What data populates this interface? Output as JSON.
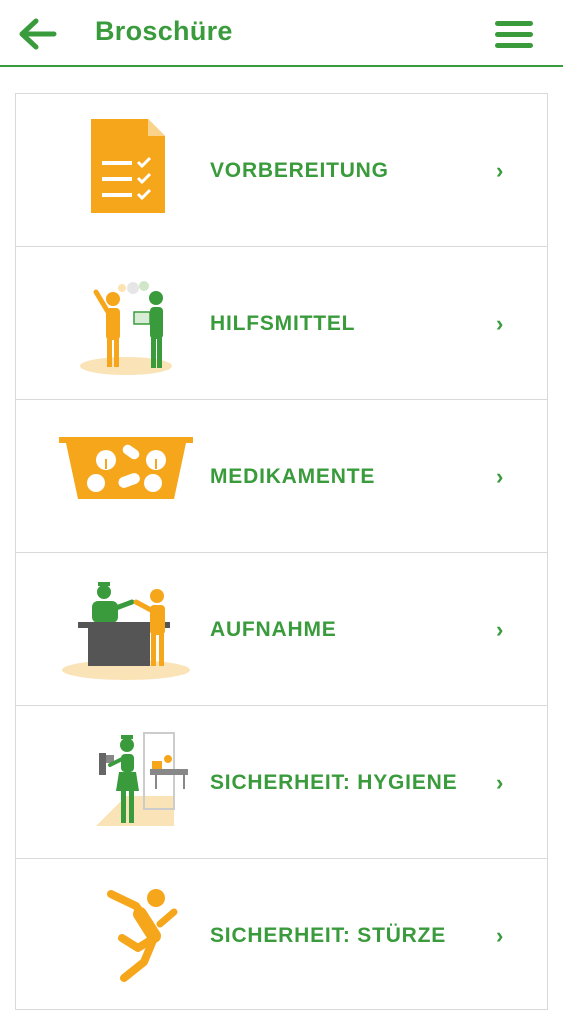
{
  "header": {
    "title": "Broschüre",
    "back_icon": "arrow-left-icon",
    "menu_icon": "hamburger-menu-icon"
  },
  "colors": {
    "green": "#3a9b3c",
    "orange": "#f6a61b",
    "beige": "#fbe3b8",
    "gray": "#555555"
  },
  "items": [
    {
      "label": "VORBEREITUNG",
      "icon": "checklist-document-icon",
      "chevron": "›"
    },
    {
      "label": "HILFSMITTEL",
      "icon": "assistive-devices-icon",
      "chevron": "›"
    },
    {
      "label": "MEDIKAMENTE",
      "icon": "medication-tray-icon",
      "chevron": "›"
    },
    {
      "label": "AUFNAHME",
      "icon": "admission-desk-icon",
      "chevron": "›"
    },
    {
      "label": "SICHERHEIT: HYGIENE",
      "icon": "hygiene-nurse-icon",
      "chevron": "›"
    },
    {
      "label": "SICHERHEIT: STÜRZE",
      "icon": "falling-person-icon",
      "chevron": "›"
    }
  ]
}
